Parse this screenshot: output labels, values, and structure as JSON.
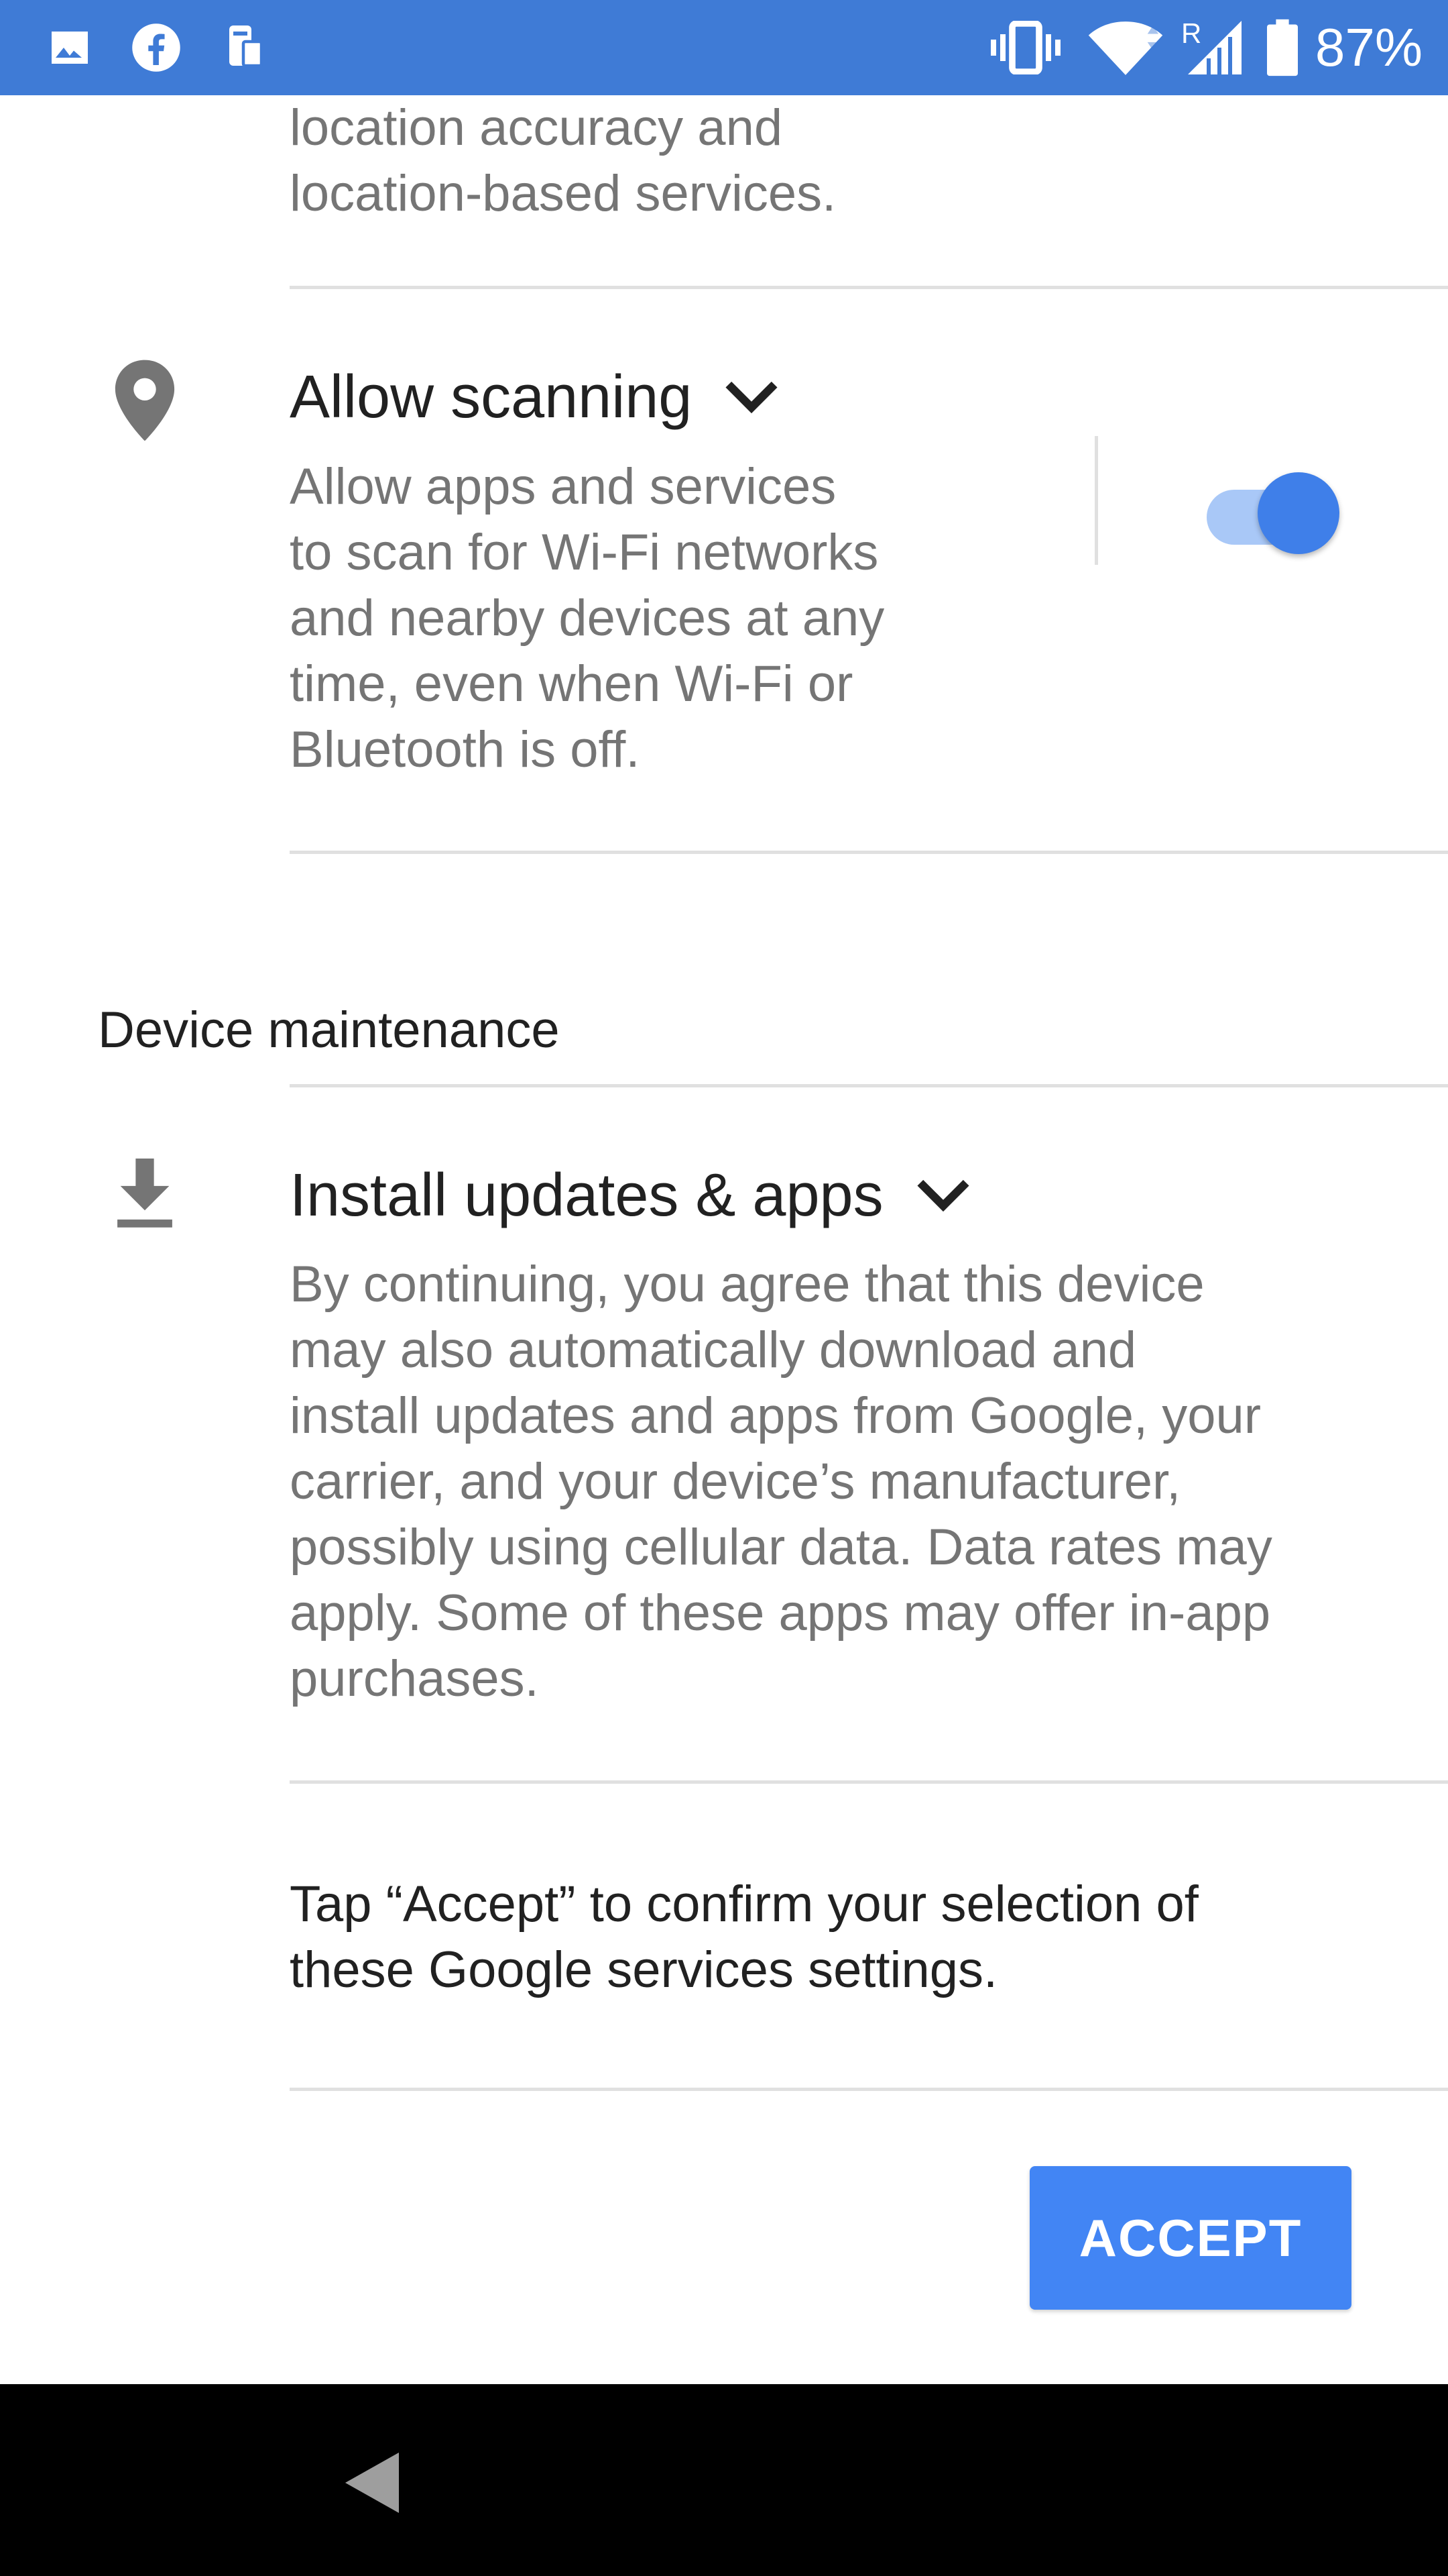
{
  "status_bar": {
    "battery_percent": "87%",
    "icons": [
      "gallery-icon",
      "facebook-icon",
      "device-transfer-icon",
      "vibrate-icon",
      "wifi-icon",
      "cellular-signal-icon",
      "battery-icon"
    ],
    "roaming_label": "R",
    "background_color": "#3f7bd6"
  },
  "intro": {
    "lines": [
      "location accuracy and",
      "location-based services."
    ]
  },
  "allow_scanning": {
    "title": "Allow scanning",
    "body_lines": [
      "Allow apps and services",
      "to scan for Wi-Fi networks",
      "and nearby devices at any",
      "time, even when Wi-Fi or",
      "Bluetooth is off."
    ],
    "icon": "location-pin-icon",
    "toggle_on": true
  },
  "device_maintenance": {
    "header": "Device maintenance"
  },
  "install_updates": {
    "title": "Install updates & apps",
    "body_lines": [
      "By continuing, you agree that this device",
      "may also automatically download and",
      "install updates and apps from Google, your",
      "carrier, and your device’s manufacturer,",
      "possibly using cellular data. Data rates may",
      "apply. Some of these apps may offer in-app",
      "purchases."
    ],
    "icon": "download-icon"
  },
  "confirm": {
    "lines": [
      "Tap “Accept” to confirm your selection of",
      "these Google services settings."
    ]
  },
  "accept_button": {
    "label": "ACCEPT",
    "color": "#4285f4"
  },
  "nav_bar": {
    "icons": [
      "back-icon"
    ]
  }
}
